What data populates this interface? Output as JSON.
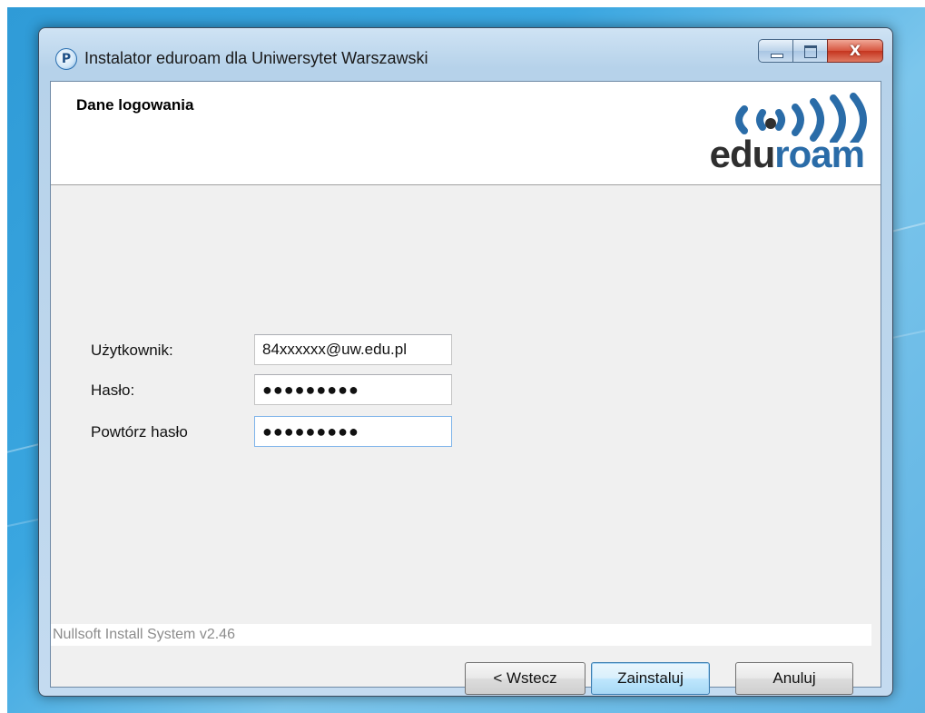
{
  "window": {
    "title": "Instalator eduroam dla Uniwersytet Warszawski",
    "icon": "eduroam-installer-icon",
    "close_label": "X"
  },
  "header": {
    "title": "Dane logowania",
    "logo_text_edu": "edu",
    "logo_text_roam": "roam",
    "logo_colors": {
      "edu": "#2f2f2f",
      "roam": "#2a6ca8"
    }
  },
  "form": {
    "username": {
      "label": "Użytkownik:",
      "value": "84xxxxxx@uw.edu.pl"
    },
    "password": {
      "label": "Hasło:",
      "value": "●●●●●●●●●"
    },
    "password_repeat": {
      "label": "Powtórz hasło",
      "value": "●●●●●●●●●"
    }
  },
  "footer": {
    "branding": "Nullsoft Install System v2.46",
    "back_label": "< Wstecz",
    "install_label": "Zainstaluj",
    "cancel_label": "Anuluj"
  }
}
